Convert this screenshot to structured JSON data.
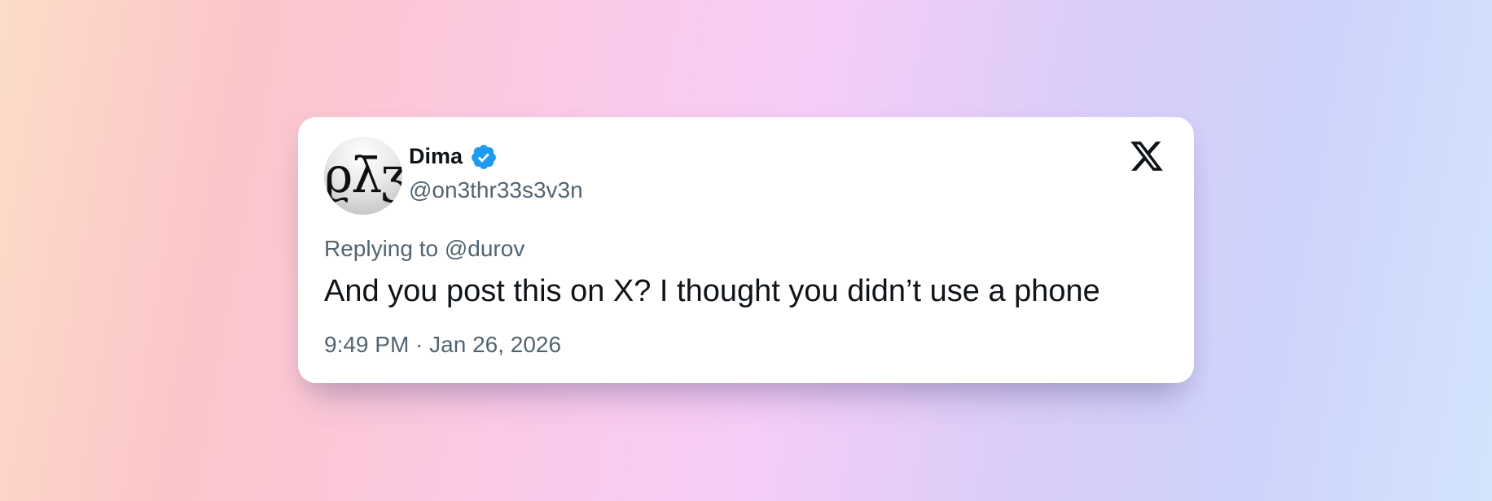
{
  "tweet": {
    "author": {
      "display_name": "Dima",
      "handle": "@on3thr33s3v3n",
      "avatar_text": "ϱλ̄ʒ",
      "verified": true
    },
    "replying_to": "Replying to @durov",
    "text": "And you post this on X? I thought you didn’t use a phone",
    "timestamp": "9:49 PM · Jan 26, 2026"
  },
  "icons": {
    "verified": "verified-badge-icon",
    "platform_logo": "x-logo-icon"
  },
  "colors": {
    "verified_blue": "#1d9bf0",
    "text_primary": "#0f1419",
    "text_secondary": "#536471",
    "card_background": "#ffffff"
  }
}
